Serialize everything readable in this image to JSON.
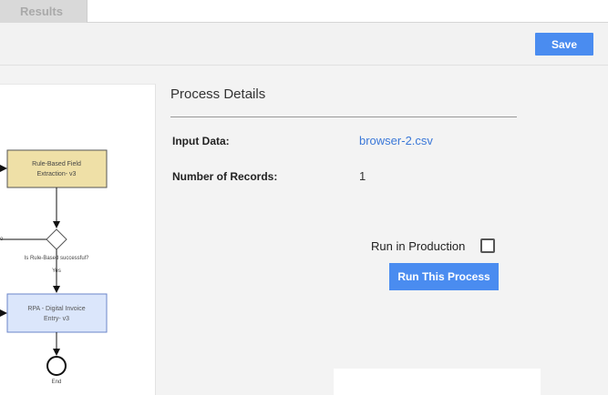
{
  "tabs": [
    {
      "label": "Results"
    }
  ],
  "toolbar": {
    "save_label": "Save"
  },
  "flow": {
    "node1_line1": "Rule-Based Field",
    "node1_line2": "Extraction- v3",
    "decision_label": "Is Rule-Based successful?",
    "branch_left_fragment": "o",
    "branch_yes": "Yes",
    "node2_line1": "RPA - Digital Invoice",
    "node2_line2": "Entry- v3",
    "end_label": "End",
    "colors": {
      "node1_fill": "#efe0a7",
      "node1_border": "#555",
      "node2_fill": "#dbe6fb",
      "node2_border": "#6b85c9"
    }
  },
  "details": {
    "title": "Process Details",
    "input_label": "Input Data:",
    "input_value": "browser-2.csv",
    "records_label": "Number of Records:",
    "records_value": "1",
    "run_in_production_label": "Run in Production",
    "run_in_production_checked": false,
    "run_button_label": "Run This Process"
  },
  "colors": {
    "accent": "#4a8cf0",
    "link": "#3b78d8"
  }
}
